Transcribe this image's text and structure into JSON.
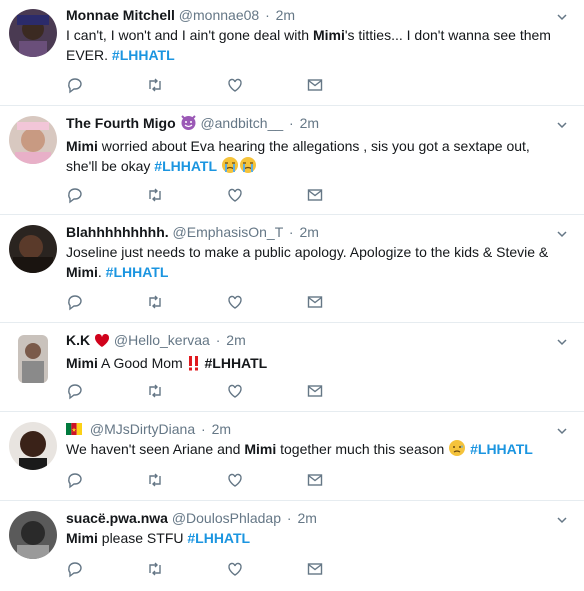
{
  "tweets": [
    {
      "name": "Monnae Mitchell",
      "handle": "@monnae08",
      "time": "2m",
      "text_parts": [
        "I can't, I won't and I ain't gone deal with ",
        "Mimi",
        "'s titties... I don't wanna see them EVER.  ",
        "#LHHATL"
      ]
    },
    {
      "name": "The Fourth Migo",
      "handle": "@andbitch__",
      "time": "2m",
      "text_parts": [
        "Mimi",
        " worried about Eva hearing the allegations , sis you got a sextape out, she'll be okay ",
        "#LHHATL"
      ]
    },
    {
      "name": "Blahhhhhhhhh.",
      "handle": "@EmphasisOn_T",
      "time": "2m",
      "text_parts": [
        "Joseline just needs to make a public apology. Apologize to the kids & Stevie & ",
        "Mimi",
        ". ",
        "#LHHATL"
      ]
    },
    {
      "name": "K.K",
      "handle": "@Hello_kervaa",
      "time": "2m",
      "text_parts": [
        "Mimi",
        " A Good Mom ",
        "#LHHATL"
      ]
    },
    {
      "name": "",
      "handle": "@MJsDirtyDiana",
      "time": "2m",
      "text_parts": [
        "We haven't seen Ariane and ",
        "Mimi",
        " together much this season ",
        "#LHHATL"
      ]
    },
    {
      "name": "suacë.pwa.nwa",
      "handle": "@DoulosPhladap",
      "time": "2m",
      "text_parts": [
        "Mimi",
        " please STFU ",
        "#LHHATL"
      ]
    }
  ],
  "icons": {
    "reply": "reply-icon",
    "retweet": "retweet-icon",
    "like": "heart-icon",
    "dm": "envelope-icon",
    "menu": "chevron-down-icon"
  },
  "colors": {
    "hashtag": "#1b95e0",
    "muted": "#657786",
    "divider": "#e6ecf0"
  }
}
